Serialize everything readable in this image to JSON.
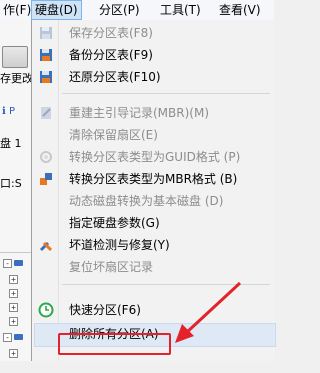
{
  "menubar": {
    "items": [
      {
        "label": "作(F)",
        "active": false
      },
      {
        "label": "硬盘(D)",
        "active": true
      },
      {
        "label": "分区(P)",
        "active": false
      },
      {
        "label": "工具(T)",
        "active": false
      },
      {
        "label": "查看(V)",
        "active": false
      }
    ]
  },
  "background": {
    "left_texts": [
      "存更改",
      "盘 1",
      "口:S",
      "ℹ P"
    ]
  },
  "menu": {
    "items": [
      {
        "label": "保存分区表(F8)",
        "enabled": false,
        "icon": "save-icon"
      },
      {
        "label": "备份分区表(F9)",
        "enabled": true,
        "icon": "backup-icon"
      },
      {
        "label": "还原分区表(F10)",
        "enabled": true,
        "icon": "restore-icon"
      },
      {
        "label": "重建主引导记录(MBR)(M)",
        "enabled": false,
        "icon": "rebuild-mbr-icon"
      },
      {
        "label": "清除保留扇区(E)",
        "enabled": false,
        "icon": ""
      },
      {
        "label": "转换分区表类型为GUID格式 (P)",
        "enabled": false,
        "icon": "convert-guid-icon"
      },
      {
        "label": "转换分区表类型为MBR格式 (B)",
        "enabled": true,
        "icon": "convert-mbr-icon"
      },
      {
        "label": "动态磁盘转换为基本磁盘 (D)",
        "enabled": false,
        "icon": ""
      },
      {
        "label": "指定硬盘参数(G)",
        "enabled": true,
        "icon": ""
      },
      {
        "label": "坏道检测与修复(Y)",
        "enabled": true,
        "icon": "tools-icon"
      },
      {
        "label": "复位坏扇区记录",
        "enabled": false,
        "icon": ""
      },
      {
        "label": "快速分区(F6)",
        "enabled": true,
        "icon": "quick-partition-icon"
      },
      {
        "label": "删除所有分区(A)",
        "enabled": true,
        "icon": ""
      }
    ]
  },
  "colors": {
    "annotation": "#e3222a",
    "highlight": "#dfe8f5"
  }
}
